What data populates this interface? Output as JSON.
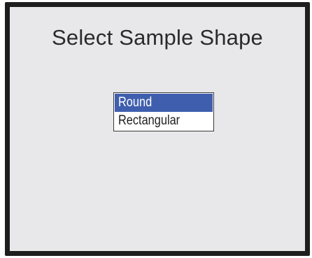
{
  "screen": {
    "title": "Select Sample Shape"
  },
  "shape_list": {
    "options": [
      {
        "label": "Round",
        "selected": true
      },
      {
        "label": "Rectangular",
        "selected": false
      }
    ],
    "selected_color": "#3f5fae"
  }
}
